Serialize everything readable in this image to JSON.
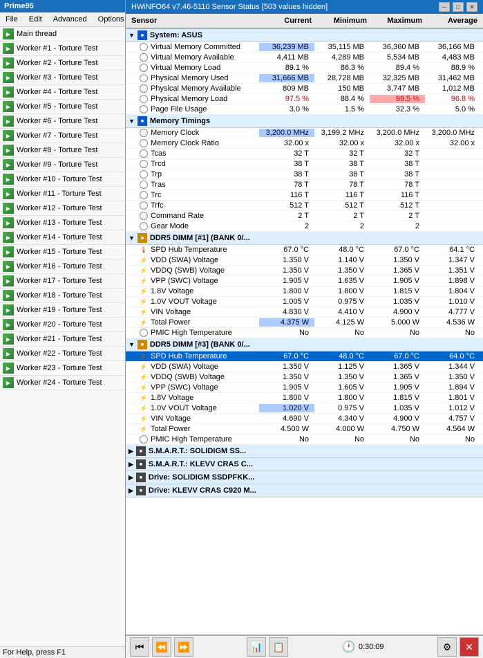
{
  "prime95": {
    "title": "Prime95",
    "menu": [
      "File",
      "Edit",
      "Advanced",
      "Options"
    ],
    "threads": [
      {
        "label": "Main thread"
      },
      {
        "label": "Worker #1 - Torture Test"
      },
      {
        "label": "Worker #2 - Torture Test"
      },
      {
        "label": "Worker #3 - Torture Test"
      },
      {
        "label": "Worker #4 - Torture Test"
      },
      {
        "label": "Worker #5 - Torture Test"
      },
      {
        "label": "Worker #6 - Torture Test"
      },
      {
        "label": "Worker #7 - Torture Test"
      },
      {
        "label": "Worker #8 - Torture Test"
      },
      {
        "label": "Worker #9 - Torture Test"
      },
      {
        "label": "Worker #10 - Torture Test"
      },
      {
        "label": "Worker #11 - Torture Test"
      },
      {
        "label": "Worker #12 - Torture Test"
      },
      {
        "label": "Worker #13 - Torture Test"
      },
      {
        "label": "Worker #14 - Torture Test"
      },
      {
        "label": "Worker #15 - Torture Test"
      },
      {
        "label": "Worker #16 - Torture Test"
      },
      {
        "label": "Worker #17 - Torture Test"
      },
      {
        "label": "Worker #18 - Torture Test"
      },
      {
        "label": "Worker #19 - Torture Test"
      },
      {
        "label": "Worker #20 - Torture Test"
      },
      {
        "label": "Worker #21 - Torture Test"
      },
      {
        "label": "Worker #22 - Torture Test"
      },
      {
        "label": "Worker #23 - Torture Test"
      },
      {
        "label": "Worker #24 - Torture Test"
      }
    ],
    "status": "For Help, press F1"
  },
  "hwinfo": {
    "title": "HWiNFO64 v7.46-5110 Sensor Status [503 values hidden]",
    "header": {
      "sensor": "Sensor",
      "current": "Current",
      "minimum": "Minimum",
      "maximum": "Maximum",
      "average": "Average"
    },
    "sections": [
      {
        "id": "system-asus",
        "label": "System: ASUS",
        "expanded": true,
        "rows": [
          {
            "name": "Virtual Memory Committed",
            "icon": "circle",
            "current": "36,239 MB",
            "minimum": "35,115 MB",
            "maximum": "36,360 MB",
            "average": "36,166 MB",
            "cur_hl": "blue"
          },
          {
            "name": "Virtual Memory Available",
            "icon": "circle",
            "current": "4,411 MB",
            "minimum": "4,289 MB",
            "maximum": "5,534 MB",
            "average": "4,483 MB"
          },
          {
            "name": "Virtual Memory Load",
            "icon": "circle",
            "current": "89.1 %",
            "minimum": "86.3 %",
            "maximum": "89.4 %",
            "average": "88.9 %"
          },
          {
            "name": "Physical Memory Used",
            "icon": "circle",
            "current": "31,666 MB",
            "minimum": "28,728 MB",
            "maximum": "32,325 MB",
            "average": "31,462 MB",
            "cur_hl": "blue"
          },
          {
            "name": "Physical Memory Available",
            "icon": "circle",
            "current": "809 MB",
            "minimum": "150 MB",
            "maximum": "3,747 MB",
            "average": "1,012 MB"
          },
          {
            "name": "Physical Memory Load",
            "icon": "circle",
            "current": "97.5 %",
            "minimum": "88.4 %",
            "maximum": "99.5 %",
            "average": "96.8 %",
            "cur_red": true,
            "max_red": true,
            "avg_red": true
          },
          {
            "name": "Page File Usage",
            "icon": "circle",
            "current": "3.0 %",
            "minimum": "1.5 %",
            "maximum": "32.3 %",
            "average": "5.0 %"
          }
        ]
      },
      {
        "id": "memory-timings",
        "label": "Memory Timings",
        "expanded": true,
        "rows": [
          {
            "name": "Memory Clock",
            "icon": "circle",
            "current": "3,200.0 MHz",
            "minimum": "3,199.2 MHz",
            "maximum": "3,200.0 MHz",
            "average": "3,200.0 MHz",
            "cur_hl": "blue"
          },
          {
            "name": "Memory Clock Ratio",
            "icon": "circle",
            "current": "32.00 x",
            "minimum": "32.00 x",
            "maximum": "32.00 x",
            "average": "32.00 x"
          },
          {
            "name": "Tcas",
            "icon": "circle",
            "current": "32 T",
            "minimum": "32 T",
            "maximum": "32 T",
            "average": ""
          },
          {
            "name": "Trcd",
            "icon": "circle",
            "current": "38 T",
            "minimum": "38 T",
            "maximum": "38 T",
            "average": ""
          },
          {
            "name": "Trp",
            "icon": "circle",
            "current": "38 T",
            "minimum": "38 T",
            "maximum": "38 T",
            "average": ""
          },
          {
            "name": "Tras",
            "icon": "circle",
            "current": "78 T",
            "minimum": "78 T",
            "maximum": "78 T",
            "average": ""
          },
          {
            "name": "Trc",
            "icon": "circle",
            "current": "116 T",
            "minimum": "116 T",
            "maximum": "116 T",
            "average": ""
          },
          {
            "name": "Trfc",
            "icon": "circle",
            "current": "512 T",
            "minimum": "512 T",
            "maximum": "512 T",
            "average": ""
          },
          {
            "name": "Command Rate",
            "icon": "circle",
            "current": "2 T",
            "minimum": "2 T",
            "maximum": "2 T",
            "average": ""
          },
          {
            "name": "Gear Mode",
            "icon": "circle",
            "current": "2",
            "minimum": "2",
            "maximum": "2",
            "average": ""
          }
        ]
      },
      {
        "id": "ddr5-dimm1",
        "label": "DDR5 DIMM [#1] (BANK 0/...",
        "expanded": true,
        "rows": [
          {
            "name": "SPD Hub Temperature",
            "icon": "temp",
            "current": "67.0 °C",
            "minimum": "48.0 °C",
            "maximum": "67.0 °C",
            "average": "64.1 °C"
          },
          {
            "name": "VDD (SWA) Voltage",
            "icon": "lightning",
            "current": "1.350 V",
            "minimum": "1.140 V",
            "maximum": "1.350 V",
            "average": "1.347 V"
          },
          {
            "name": "VDDQ (SWB) Voltage",
            "icon": "lightning",
            "current": "1.350 V",
            "minimum": "1.350 V",
            "maximum": "1.365 V",
            "average": "1.351 V"
          },
          {
            "name": "VPP (SWC) Voltage",
            "icon": "lightning",
            "current": "1.905 V",
            "minimum": "1.635 V",
            "maximum": "1.905 V",
            "average": "1.898 V"
          },
          {
            "name": "1.8V Voltage",
            "icon": "lightning",
            "current": "1.800 V",
            "minimum": "1.800 V",
            "maximum": "1.815 V",
            "average": "1.804 V"
          },
          {
            "name": "1.0V VOUT Voltage",
            "icon": "lightning",
            "current": "1.005 V",
            "minimum": "0.975 V",
            "maximum": "1.035 V",
            "average": "1.010 V"
          },
          {
            "name": "VIN Voltage",
            "icon": "lightning",
            "current": "4.830 V",
            "minimum": "4.410 V",
            "maximum": "4.900 V",
            "average": "4.777 V"
          },
          {
            "name": "Total Power",
            "icon": "lightning",
            "current": "4.375 W",
            "minimum": "4.125 W",
            "maximum": "5.000 W",
            "average": "4.536 W",
            "cur_hl": "blue"
          },
          {
            "name": "PMIC High Temperature",
            "icon": "circle",
            "current": "No",
            "minimum": "No",
            "maximum": "No",
            "average": "No"
          }
        ]
      },
      {
        "id": "ddr5-dimm3",
        "label": "DDR5 DIMM [#3] (BANK 0/...",
        "expanded": true,
        "rows": [
          {
            "name": "SPD Hub Temperature",
            "icon": "temp",
            "current": "67.0 °C",
            "minimum": "48.0 °C",
            "maximum": "67.0 °C",
            "average": "64.0 °C",
            "selected": true
          },
          {
            "name": "VDD (SWA) Voltage",
            "icon": "lightning",
            "current": "1.350 V",
            "minimum": "1.125 V",
            "maximum": "1.365 V",
            "average": "1.344 V"
          },
          {
            "name": "VDDQ (SWB) Voltage",
            "icon": "lightning",
            "current": "1.350 V",
            "minimum": "1.350 V",
            "maximum": "1.365 V",
            "average": "1.350 V"
          },
          {
            "name": "VPP (SWC) Voltage",
            "icon": "lightning",
            "current": "1.905 V",
            "minimum": "1.605 V",
            "maximum": "1.905 V",
            "average": "1.894 V"
          },
          {
            "name": "1.8V Voltage",
            "icon": "lightning",
            "current": "1.800 V",
            "minimum": "1.800 V",
            "maximum": "1.815 V",
            "average": "1.801 V"
          },
          {
            "name": "1.0V VOUT Voltage",
            "icon": "lightning",
            "current": "1.020 V",
            "minimum": "0.975 V",
            "maximum": "1.035 V",
            "average": "1.012 V",
            "cur_hl": "blue"
          },
          {
            "name": "VIN Voltage",
            "icon": "lightning",
            "current": "4.690 V",
            "minimum": "4.340 V",
            "maximum": "4.900 V",
            "average": "4.757 V"
          },
          {
            "name": "Total Power",
            "icon": "lightning",
            "current": "4.500 W",
            "minimum": "4.000 W",
            "maximum": "4.750 W",
            "average": "4.564 W"
          },
          {
            "name": "PMIC High Temperature",
            "icon": "circle",
            "current": "No",
            "minimum": "No",
            "maximum": "No",
            "average": "No"
          }
        ]
      },
      {
        "id": "smart-solidigm",
        "label": "S.M.A.R.T.: SOLIDIGM SS...",
        "expanded": false,
        "rows": []
      },
      {
        "id": "smart-klevv",
        "label": "S.M.A.R.T.: KLEVV CRAS C...",
        "expanded": false,
        "rows": []
      },
      {
        "id": "drive-solidigm",
        "label": "Drive: SOLIDIGM SSDPFKK...",
        "expanded": false,
        "rows": []
      },
      {
        "id": "drive-klevv",
        "label": "Drive: KLEVV CRAS C920 M...",
        "expanded": false,
        "rows": []
      }
    ],
    "footer": {
      "time": "0:30:09"
    }
  }
}
